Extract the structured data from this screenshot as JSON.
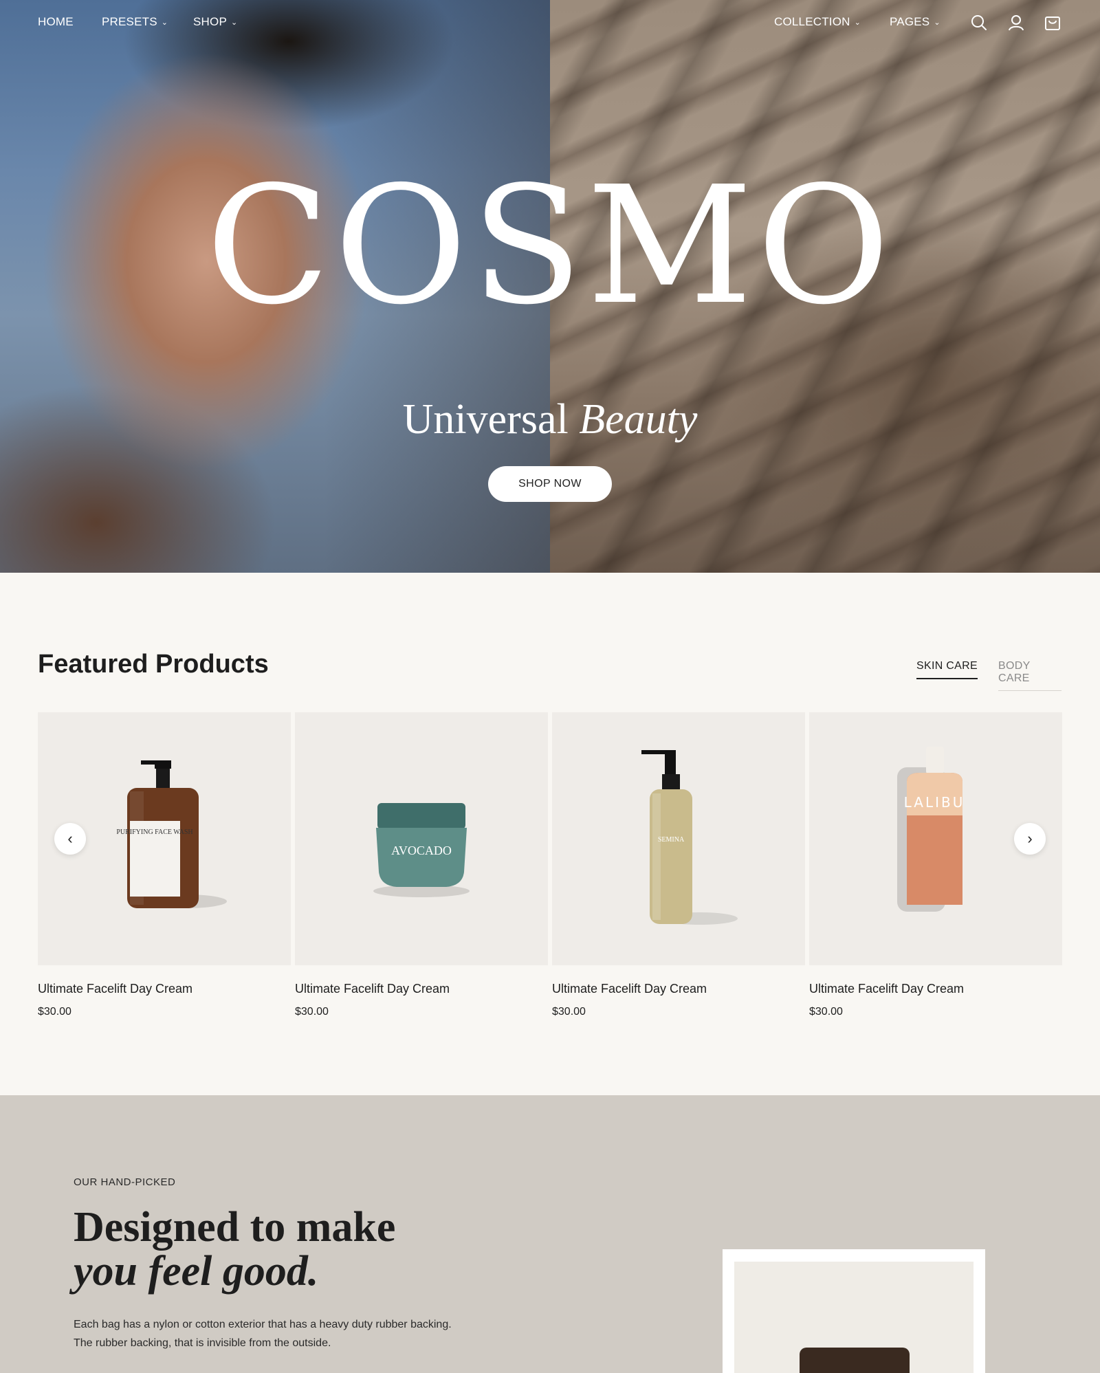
{
  "nav": {
    "left": [
      {
        "label": "HOME",
        "dropdown": false
      },
      {
        "label": "PRESETS",
        "dropdown": true
      },
      {
        "label": "SHOP",
        "dropdown": true
      }
    ],
    "right": [
      {
        "label": "COLLECTION",
        "dropdown": true
      },
      {
        "label": "PAGES",
        "dropdown": true
      }
    ],
    "icons": [
      "search-icon",
      "user-icon",
      "cart-icon"
    ]
  },
  "hero": {
    "brand": "COSMO",
    "tagline_regular": "Universal",
    "tagline_italic": "Beauty",
    "cta": "SHOP NOW"
  },
  "featured": {
    "title": "Featured Products",
    "tabs": [
      {
        "label": "SKIN CARE",
        "active": true
      },
      {
        "label": "BODY CARE",
        "active": false
      }
    ],
    "products": [
      {
        "name": "Ultimate Facelift Day Cream",
        "price": "$30.00",
        "label": "PURIFYING FACE WASH",
        "art": "amber-pump-bottle"
      },
      {
        "name": "Ultimate Facelift Day Cream",
        "price": "$30.00",
        "label": "AVOCADO",
        "art": "teal-jar"
      },
      {
        "name": "Ultimate Facelift Day Cream",
        "price": "$30.00",
        "label": "SEMINA",
        "art": "clear-pump-bottle"
      },
      {
        "name": "Ultimate Facelift Day Cream",
        "price": "$30.00",
        "label": "LALIBU",
        "art": "peach-bottle"
      }
    ],
    "prev_icon": "chevron-left-icon",
    "next_icon": "chevron-right-icon"
  },
  "promo": {
    "eyebrow": "OUR HAND-PICKED",
    "headline_line1": "Designed to make",
    "headline_line2": "you feel good.",
    "description": "Each bag has a nylon or cotton exterior that has a heavy duty rubber backing. The rubber backing, that is invisible from the outside."
  },
  "colors": {
    "page_bg": "#f9f7f3",
    "card_bg": "#efece8",
    "promo_bg": "#d0cbc4",
    "text": "#1e1e1e"
  }
}
